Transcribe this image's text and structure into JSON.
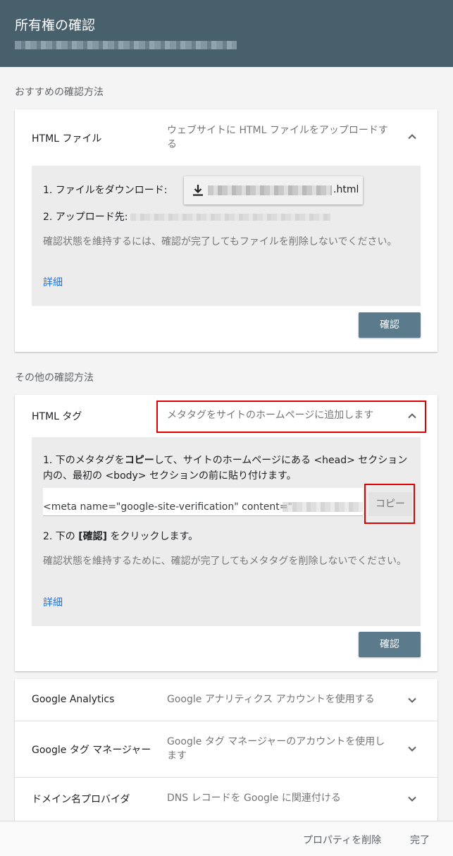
{
  "dialog": {
    "title": "所有権の確認"
  },
  "sections": {
    "recommended": "おすすめの確認方法",
    "other": "その他の確認方法"
  },
  "html_file": {
    "name": "HTML ファイル",
    "desc": "ウェブサイトに HTML ファイルをアップロードする",
    "step1": "1. ファイルをダウンロード:",
    "download_suffix": ".html",
    "step2": "2. アップロード先:",
    "note": "確認状態を維持するには、確認が完了してもファイルを削除しないでください。",
    "details": "詳細",
    "confirm": "確認"
  },
  "html_tag": {
    "name": "HTML タグ",
    "desc": "メタタグをサイトのホームページに追加します",
    "step1_pre": "1. 下のメタタグを",
    "step1_bold": "コピー",
    "step1_post": "して、サイトのホームページにある <head> セクション内の、最初の <body> セクションの前に貼り付けます。",
    "meta_value": "<meta name=\"google-site-verification\" content=\"",
    "copy": "コピー",
    "step2_pre": "2. 下の ",
    "step2_bold": "[確認]",
    "step2_post": " をクリックします。",
    "note": "確認状態を維持するために、確認が完了してもメタタグを削除しないでください。",
    "details": "詳細",
    "confirm": "確認"
  },
  "methods": [
    {
      "name": "Google Analytics",
      "desc": "Google アナリティクス アカウントを使用する"
    },
    {
      "name": "Google タグ マネージャー",
      "desc": "Google タグ マネージャーのアカウントを使用します"
    },
    {
      "name": "ドメイン名プロバイダ",
      "desc": "DNS レコードを Google に関連付ける"
    }
  ],
  "footer": {
    "delete": "プロパティを削除",
    "done": "完了"
  },
  "colors": {
    "header_bg": "#485f6c",
    "confirm_bg": "#5b7a8b",
    "link": "#1a73e8",
    "highlight": "#e00000"
  }
}
